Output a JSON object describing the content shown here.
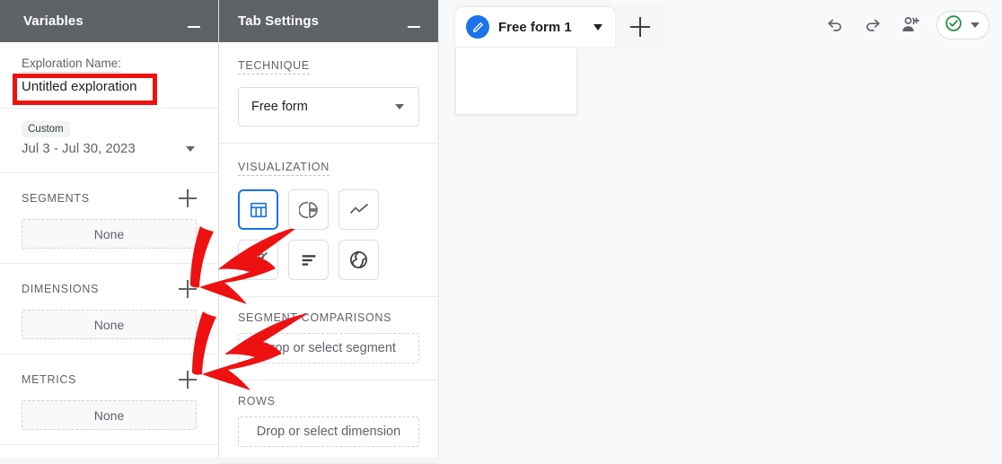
{
  "variables_panel": {
    "header_title": "Variables",
    "collapse_icon": "minimize-icon",
    "exploration_name_label": "Exploration Name:",
    "exploration_name_value": "Untitled exploration",
    "date_range_chip": "Custom",
    "date_range_value": "Jul 3 - Jul 30, 2023",
    "groups": [
      {
        "title": "SEGMENTS",
        "add_icon": "plus-icon",
        "dropzone": "None"
      },
      {
        "title": "DIMENSIONS",
        "add_icon": "plus-icon",
        "dropzone": "None"
      },
      {
        "title": "METRICS",
        "add_icon": "plus-icon",
        "dropzone": "None"
      }
    ]
  },
  "tab_settings_panel": {
    "header_title": "Tab Settings",
    "collapse_icon": "minimize-icon",
    "technique_label": "TECHNIQUE",
    "technique_value": "Free form",
    "technique_caret": "chevron-down-icon",
    "visualization_label": "VISUALIZATION",
    "visualizations": [
      {
        "name": "free-form-table-icon",
        "selected": true
      },
      {
        "name": "donut-chart-icon",
        "selected": false
      },
      {
        "name": "line-chart-icon",
        "selected": false
      },
      {
        "name": "scatter-plot-icon",
        "selected": false
      },
      {
        "name": "bar-chart-icon",
        "selected": false
      },
      {
        "name": "geo-map-icon",
        "selected": false
      }
    ],
    "segment_comparisons_label": "SEGMENT COMPARISONS",
    "segment_comparisons_dropzone": "Drop or select segment",
    "rows_label": "ROWS",
    "rows_dropzone": "Drop or select dimension"
  },
  "main_panel": {
    "tab_label": "Free form 1",
    "tab_icon": "pencil-icon",
    "tab_caret_icon": "chevron-down-icon",
    "add_tab_icon": "plus-icon",
    "actions": [
      {
        "name": "undo-icon"
      },
      {
        "name": "redo-icon"
      },
      {
        "name": "share-add-person-icon"
      }
    ],
    "status_icon": "green-check-circle-icon",
    "status_caret_icon": "chevron-down-icon"
  },
  "annotations": {
    "highlight_box": {
      "name": "red-highlight-box",
      "color": "#ee1111"
    },
    "arrows": [
      {
        "name": "red-arrow-to-dimensions-add",
        "color": "#ee1111"
      },
      {
        "name": "red-arrow-to-metrics-add",
        "color": "#ee1111"
      }
    ]
  },
  "colors": {
    "panel_header_bg": "#5f6368",
    "accent_blue": "#1a73e8",
    "annotation_red": "#ee1111",
    "status_green": "#1e8e3e"
  }
}
